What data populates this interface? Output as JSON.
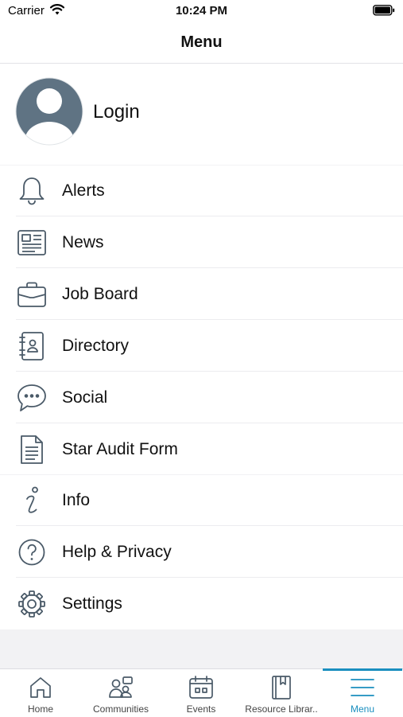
{
  "status_bar": {
    "carrier": "Carrier",
    "time": "10:24 PM"
  },
  "nav": {
    "title": "Menu"
  },
  "profile": {
    "login_label": "Login"
  },
  "menu_primary": [
    {
      "label": "Alerts",
      "icon": "bell-icon"
    },
    {
      "label": "News",
      "icon": "newspaper-icon"
    },
    {
      "label": "Job Board",
      "icon": "briefcase-icon"
    },
    {
      "label": "Directory",
      "icon": "address-book-icon"
    },
    {
      "label": "Social",
      "icon": "chat-bubble-icon"
    },
    {
      "label": "Star Audit Form",
      "icon": "document-icon"
    }
  ],
  "menu_secondary": [
    {
      "label": "Info",
      "icon": "info-icon"
    },
    {
      "label": "Help & Privacy",
      "icon": "question-icon"
    },
    {
      "label": "Settings",
      "icon": "gear-icon"
    }
  ],
  "tabs": [
    {
      "label": "Home",
      "icon": "home-icon"
    },
    {
      "label": "Communities",
      "icon": "communities-icon"
    },
    {
      "label": "Events",
      "icon": "calendar-icon"
    },
    {
      "label": "Resource Librar..",
      "icon": "bookmark-book-icon"
    },
    {
      "label": "Menu",
      "icon": "hamburger-icon",
      "active": true
    }
  ],
  "colors": {
    "accent": "#1a8fbf",
    "icon_stroke": "#4a5a68",
    "avatar": "#5f7383"
  }
}
